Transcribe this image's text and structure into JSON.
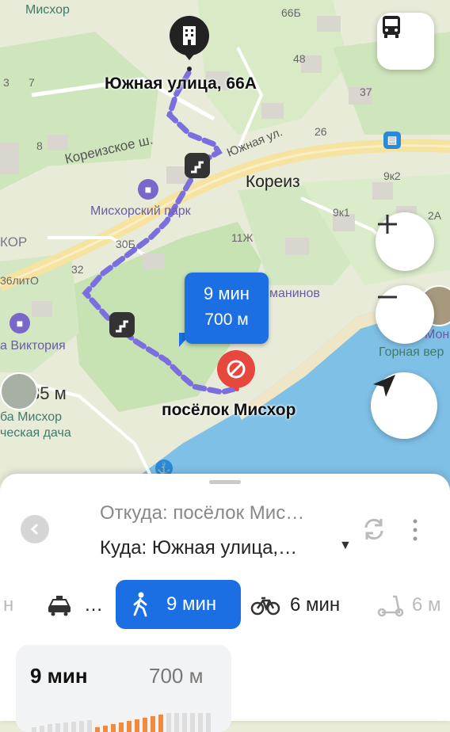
{
  "map": {
    "labels": {
      "mishor_top": "Мисхор",
      "n66b": "66Б",
      "n3": "3",
      "n7": "7",
      "n48": "48",
      "n37": "37",
      "n8": "8",
      "n26": "26",
      "koreiz_hwy": "Кореизское ш.",
      "yuzhnaya_ul": "Южная ул.",
      "koreiz": "Кореиз",
      "n9k2": "9к2",
      "mishor_park": "Мисхорский парк",
      "n9k1": "9к1",
      "n2a": "2А",
      "kor": "КОР",
      "n30b": "30Б",
      "n11zh": "11Ж",
      "n32": "32",
      "n36lito": "36литО",
      "rakhmaninov": "манинов",
      "viktoria": "а Виктория",
      "mona": "Мона",
      "gornaya": "Горная вер",
      "dist": "35 м",
      "mishor_b": "ба Мисхор",
      "dacha": "ческая дача"
    },
    "start_label": "Южная улица, 66А",
    "end_label": "посёлок Мисхор",
    "bubble": {
      "time": "9 мин",
      "distance": "700 м"
    },
    "accent_color": "#1c6fe3",
    "route_color": "#7b6fe0",
    "icons": {
      "start": "building-icon",
      "end": "no-entry-icon",
      "transit": "bus-icon",
      "zoom_in": "plus-icon",
      "zoom_out": "minus-icon",
      "locate": "navigation-arrow-icon",
      "stairs": "stairs-icon"
    }
  },
  "route": {
    "from": "Откуда: посёлок Мис…",
    "to": "Куда: Южная улица,…",
    "modes": [
      {
        "icon": "car-icon",
        "label": "н"
      },
      {
        "icon": "taxi-icon",
        "label": "…"
      },
      {
        "icon": "walk-icon",
        "label": "9 мин",
        "active": true
      },
      {
        "icon": "bicycle-icon",
        "label": "6 мин"
      },
      {
        "icon": "scooter-icon",
        "label": "6 м"
      }
    ],
    "card": {
      "time": "9 мин",
      "distance": "700 м"
    }
  }
}
